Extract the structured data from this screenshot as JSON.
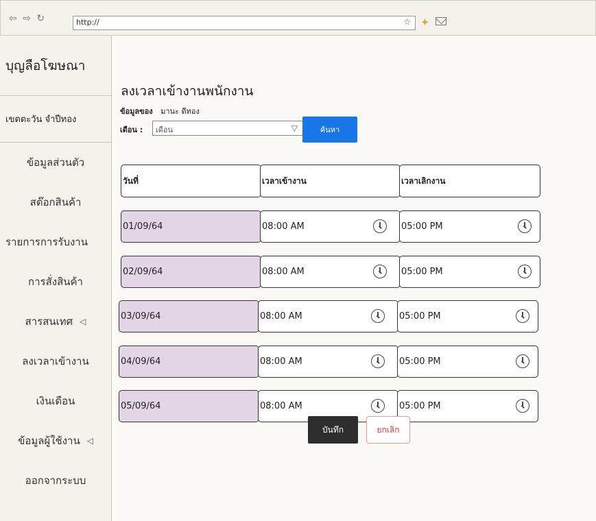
{
  "browser": {
    "nav": [
      "⇦",
      "⇨",
      "↻"
    ],
    "url": "http://",
    "star": "☆",
    "extension_icon": "puzzle-icon",
    "mail_icon": "mail-icon"
  },
  "sidebar": {
    "brand": "บุญลือโฆษณา",
    "user": "เขตตะวัน จำปีทอง",
    "items": [
      {
        "label": "ข้อมูลส่วนตัว"
      },
      {
        "label": "สต๊อกสินค้า"
      },
      {
        "label": "รายการการรับงาน"
      },
      {
        "label": "การสั่งสินค้า"
      },
      {
        "label": "สารสนเทศ"
      },
      {
        "label": "ลงเวลาเข้างาน"
      },
      {
        "label": "เงินเดือน"
      },
      {
        "label": "ข้อมูลผู้ใช้งาน"
      },
      {
        "label": "ออกจากระบบ"
      }
    ],
    "chevron": "◁"
  },
  "main": {
    "title": "ลงเวลาเข้างานพนักงาน",
    "owner_label": "ข้อมูลของ",
    "owner_name": "มานะ ดีทอง",
    "month_label": "เดือน :",
    "month_placeholder": "เดือน",
    "search_label": "ค้นหา",
    "columns": [
      "วันที่",
      "เวลาเข้างาน",
      "เวลาเลิกงาน"
    ],
    "rows": [
      {
        "date": "01/09/64",
        "start": "08:00 AM",
        "end": "05:00 PM"
      },
      {
        "date": "02/09/64",
        "start": "08:00 AM",
        "end": "05:00 PM"
      },
      {
        "date": "03/09/64",
        "start": "08:00 AM",
        "end": "05:00 PM"
      },
      {
        "date": "04/09/64",
        "start": "08:00 AM",
        "end": "05:00 PM"
      },
      {
        "date": "05/09/64",
        "start": "08:00 AM",
        "end": "05:00 PM"
      }
    ],
    "save_label": "บันทึก",
    "cancel_label": "ยกเลิก"
  },
  "colors": {
    "date_cell": "#e2d5e6",
    "primary": "#1976e9",
    "danger": "#d43b3b"
  }
}
